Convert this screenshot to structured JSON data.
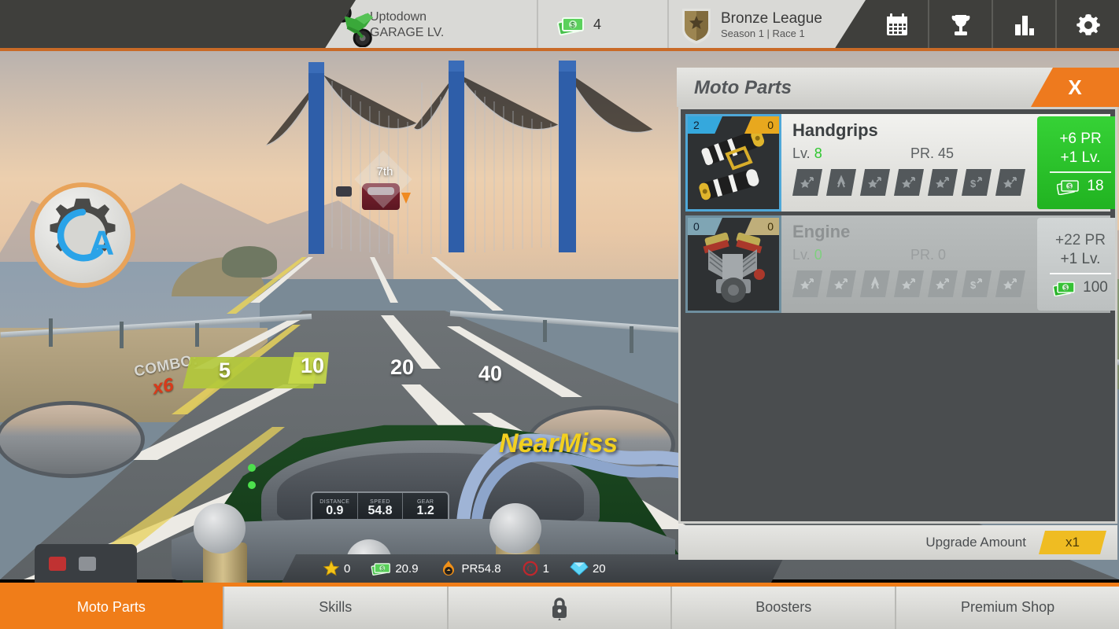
{
  "topbar": {
    "garage": {
      "player": "Uptodown",
      "label": "GARAGE LV.",
      "icon": "motorcycle-icon"
    },
    "money": {
      "value": "4",
      "icon": "cash-icon"
    },
    "league": {
      "name": "Bronze League",
      "sub": "Season 1 | Race 1",
      "icon": "shield-icon"
    },
    "icons": [
      {
        "name": "calendar-icon",
        "label": "Daily Events"
      },
      {
        "name": "trophy-icon",
        "label": "Achievements"
      },
      {
        "name": "stats-icon",
        "label": "Statistics"
      },
      {
        "name": "gear-icon",
        "label": "Settings"
      }
    ]
  },
  "scene": {
    "position": "7th",
    "near_miss": "NearMiss",
    "auto_gear": {
      "label": "A",
      "icon": "auto-gear-icon"
    },
    "combo": {
      "label": "COMBO:",
      "multiplier": "x6",
      "ticks": [
        "5",
        "10",
        "20",
        "40"
      ],
      "filled": 1
    },
    "dashboard": {
      "cells": [
        {
          "label": "DISTANCE",
          "value": "0.9"
        },
        {
          "label": "SPEED",
          "value": "54.8"
        },
        {
          "label": "GEAR",
          "value": "1.2"
        }
      ]
    }
  },
  "hud": [
    {
      "icon": "star-icon",
      "value": "0"
    },
    {
      "icon": "cash-icon",
      "value": "20.9"
    },
    {
      "icon": "fire-icon",
      "value": "PR54.8"
    },
    {
      "icon": "coin-icon",
      "value": "1"
    },
    {
      "icon": "gem-icon",
      "value": "20"
    }
  ],
  "panel": {
    "title": "Moto Parts",
    "close_label": "X",
    "footer": {
      "label": "Upgrade Amount",
      "amount": "x1"
    },
    "parts": [
      {
        "name": "Handgrips",
        "thumb": "handgrips-icon",
        "badge_left": "2",
        "badge_right": "0",
        "level_label": "Lv.",
        "level": "8",
        "pr_label": "PR.",
        "pr": "45",
        "slots": 7,
        "locked": false,
        "button": {
          "pr_gain": "+6 PR",
          "lv_gain": "+1 Lv.",
          "cost": "18",
          "cost_icon": "cash-icon"
        }
      },
      {
        "name": "Engine",
        "thumb": "engine-icon",
        "badge_left": "0",
        "badge_right": "0",
        "level_label": "Lv.",
        "level": "0",
        "pr_label": "PR.",
        "pr": "0",
        "slots": 7,
        "locked": true,
        "button": {
          "pr_gain": "+22 PR",
          "lv_gain": "+1 Lv.",
          "cost": "100",
          "cost_icon": "cash-icon"
        }
      }
    ]
  },
  "bottomnav": [
    {
      "label": "Moto Parts",
      "active": true,
      "icon": null
    },
    {
      "label": "Skills",
      "active": false,
      "icon": null
    },
    {
      "label": "",
      "active": false,
      "icon": "lock-icon"
    },
    {
      "label": "Boosters",
      "active": false,
      "icon": null
    },
    {
      "label": "Premium Shop",
      "active": false,
      "icon": null
    }
  ],
  "colors": {
    "accent_orange": "#f07d19",
    "topbar_dark": "#3f3f3c",
    "panel_light": "#e6e6e3",
    "upgrade_green": "#2ecc2e",
    "badge_blue": "#35a8dd",
    "badge_gold": "#e8a81e",
    "amount_yellow": "#efbc22"
  }
}
